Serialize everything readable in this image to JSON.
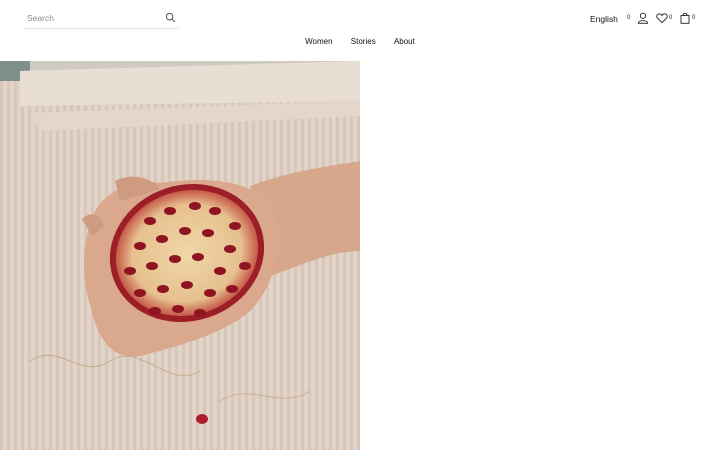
{
  "search": {
    "placeholder": "Search",
    "icon": "search-icon"
  },
  "header": {
    "language_label": "English",
    "account_count": "0",
    "wishlist_count": "0",
    "cart_count": "0"
  },
  "nav": {
    "items": [
      {
        "label": "Women"
      },
      {
        "label": "Stories"
      },
      {
        "label": "About"
      }
    ]
  },
  "hero": {
    "image": "hands-holding-pomegranate-photo"
  },
  "colors": {
    "background": "#ffffff",
    "text": "#111111",
    "placeholder": "#8a8a8a",
    "divider": "#e4e4e4"
  }
}
